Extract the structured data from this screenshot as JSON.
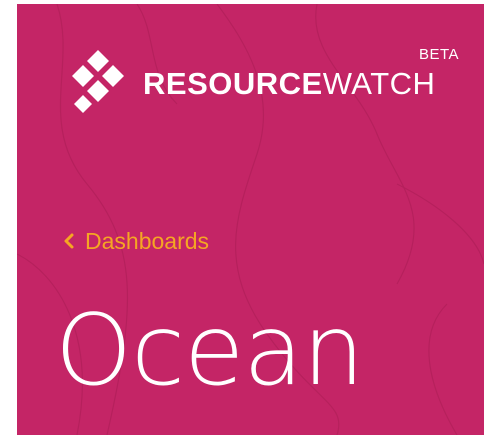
{
  "brand": {
    "name_bold": "RESOURCE",
    "name_light": "WATCH",
    "badge": "BETA",
    "logo_icon": "resource-watch-logo-icon"
  },
  "navigation": {
    "back_label": "Dashboards",
    "back_icon": "chevron-left-icon"
  },
  "page": {
    "title": "Ocean"
  },
  "colors": {
    "background": "#c42566",
    "link": "#f5a623",
    "text": "#ffffff"
  }
}
